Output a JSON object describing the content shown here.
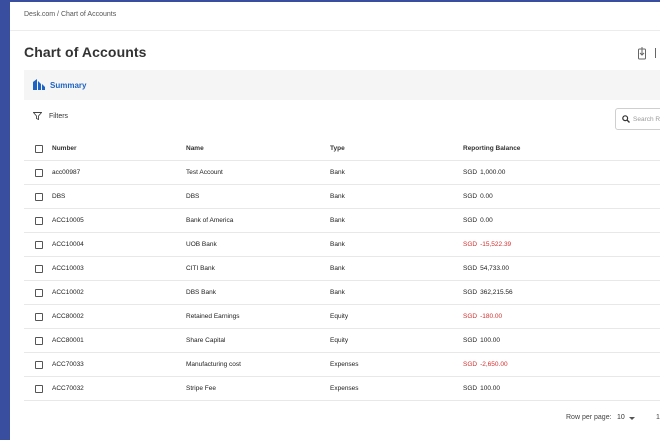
{
  "breadcrumb": "Desk.com / Chart of Accounts",
  "page_title": "Chart of Accounts",
  "summary": {
    "label": "Summary"
  },
  "filters": {
    "label": "Filters"
  },
  "search": {
    "placeholder": "Search Re"
  },
  "table": {
    "headers": {
      "number": "Number",
      "name": "Name",
      "type": "Type",
      "balance": "Reporting Balance"
    },
    "rows": [
      {
        "number": "acc00987",
        "name": "Test Account",
        "type": "Bank",
        "currency": "SGD",
        "balance": "1,000.00",
        "negative": false
      },
      {
        "number": "DBS",
        "name": "DBS",
        "type": "Bank",
        "currency": "SGD",
        "balance": "0.00",
        "negative": false
      },
      {
        "number": "ACC10005",
        "name": "Bank of America",
        "type": "Bank",
        "currency": "SGD",
        "balance": "0.00",
        "negative": false
      },
      {
        "number": "ACC10004",
        "name": "UOB Bank",
        "type": "Bank",
        "currency": "SGD",
        "balance": "-15,522.39",
        "negative": true
      },
      {
        "number": "ACC10003",
        "name": "CITI Bank",
        "type": "Bank",
        "currency": "SGD",
        "balance": "54,733.00",
        "negative": false
      },
      {
        "number": "ACC10002",
        "name": "DBS Bank",
        "type": "Bank",
        "currency": "SGD",
        "balance": "362,215.56",
        "negative": false
      },
      {
        "number": "ACC80002",
        "name": "Retained Earnings",
        "type": "Equity",
        "currency": "SGD",
        "balance": "-180.00",
        "negative": true
      },
      {
        "number": "ACC80001",
        "name": "Share Capital",
        "type": "Equity",
        "currency": "SGD",
        "balance": "100.00",
        "negative": false
      },
      {
        "number": "ACC70033",
        "name": "Manufacturing cost",
        "type": "Expenses",
        "currency": "SGD",
        "balance": "-2,650.00",
        "negative": true
      },
      {
        "number": "ACC70032",
        "name": "Stripe Fee",
        "type": "Expenses",
        "currency": "SGD",
        "balance": "100.00",
        "negative": false
      }
    ]
  },
  "pagination": {
    "rows_label": "Row per page:",
    "rows_value": "10",
    "range": "1"
  },
  "colors": {
    "accent": "#1e63c4",
    "sidebar": "#3a4ea0",
    "negative": "#d32f2f"
  },
  "icons": {
    "summary": "summary-chart-icon",
    "filter": "filter-icon",
    "search": "search-icon",
    "export": "export-icon"
  }
}
